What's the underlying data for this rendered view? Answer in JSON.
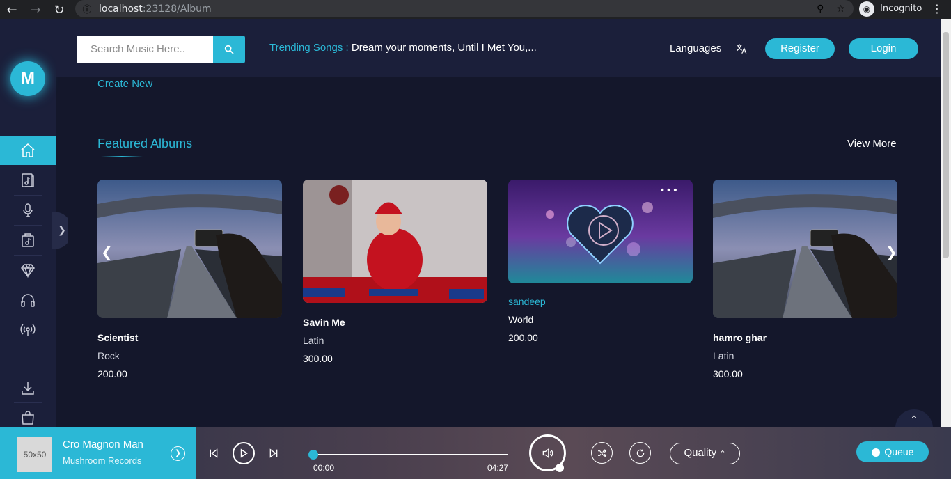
{
  "browser": {
    "url_host": "localhost",
    "url_rest": ":23128/Album",
    "profile_label": "Incognito"
  },
  "header": {
    "search_placeholder": "Search Music Here..",
    "trending_label": "Trending Songs :",
    "trending_value": "Dream your moments, Until I Met You,...",
    "languages_label": "Languages",
    "register_label": "Register",
    "login_label": "Login"
  },
  "sidebar": {
    "logo_letter": "M"
  },
  "main": {
    "create_new": "Create New",
    "section_title": "Featured Albums",
    "view_more": "View More"
  },
  "albums": [
    {
      "title": "Scientist",
      "genre": "Rock",
      "price": "200.00"
    },
    {
      "title": "Savin Me",
      "genre": "Latin",
      "price": "300.00"
    },
    {
      "title": "sandeep",
      "genre": "World",
      "price": "200.00"
    },
    {
      "title": "hamro ghar",
      "genre": "Latin",
      "price": "300.00"
    }
  ],
  "player": {
    "thumb_label": "50x50",
    "track_title": "Cro Magnon Man",
    "track_artist": "Mushroom Records",
    "time_current": "00:00",
    "time_total": "04:27",
    "progress_fraction": 0,
    "quality_label": "Quality",
    "queue_label": "Queue"
  },
  "colors": {
    "accent": "#2bb8d6",
    "background": "#14172b",
    "panel": "#1b1f3a"
  }
}
